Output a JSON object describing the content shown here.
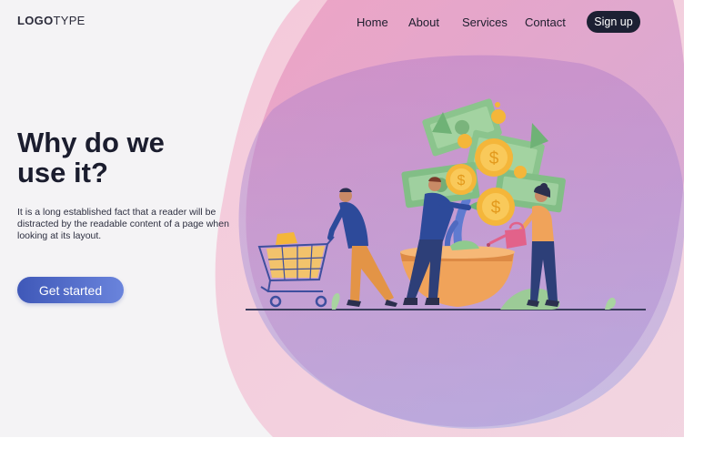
{
  "brand": {
    "logo_bold": "LOGO",
    "logo_light": "TYPE"
  },
  "nav": {
    "links": [
      "Home",
      "About",
      "Services",
      "Contact"
    ],
    "signup_label": "Sign up"
  },
  "hero": {
    "title_line1": "Why do we",
    "title_line2": "use it?",
    "description": "It is a long established fact that a reader will be distracted by the readable content of a page when looking at its layout.",
    "cta_label": "Get started"
  },
  "colors": {
    "accent_dark": "#1c2033",
    "cta_start": "#3f58b8",
    "cta_end": "#6a84dc",
    "blob_pink": "#ec8fb6",
    "blob_purple": "#9b8fd4",
    "coin_gold": "#f4b63a",
    "money_green": "#8bc48d"
  },
  "illustration": {
    "icons": [
      "shopping-cart-icon",
      "money-tree-icon",
      "coin-icon",
      "watering-can-icon"
    ]
  }
}
